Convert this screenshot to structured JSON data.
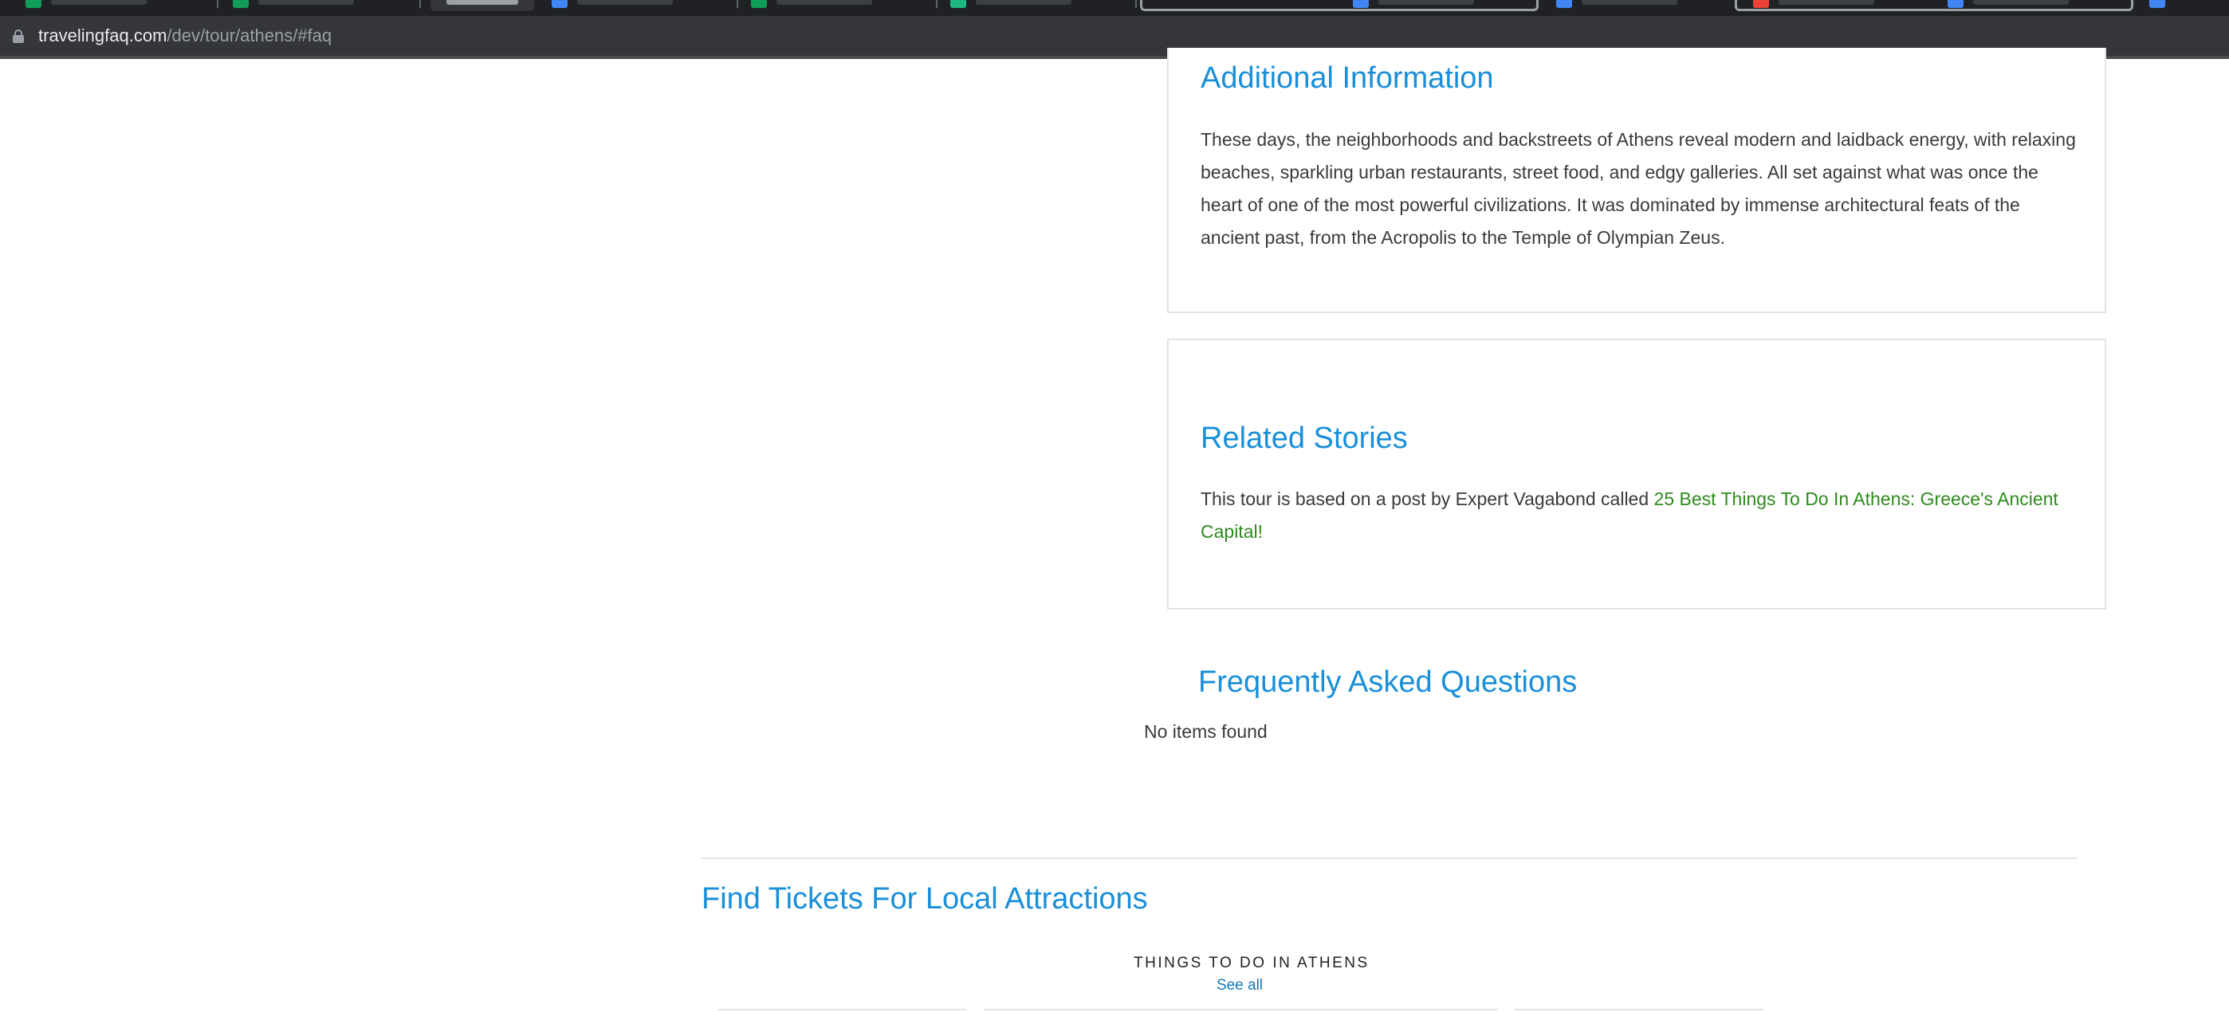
{
  "browser": {
    "url_host": "travelingfaq.com",
    "url_path": "/dev/tour/athens/#faq"
  },
  "additional_info": {
    "title": "Additional Information",
    "body": "These days, the neighborhoods and backstreets of Athens reveal modern and laidback energy, with relaxing beaches, sparkling urban restaurants, street food, and edgy galleries. All set against what was once the heart of one of the most powerful civilizations. It was dominated by immense architectural feats of the ancient past, from the Acropolis to the Temple of Olympian Zeus."
  },
  "related_stories": {
    "title": "Related Stories",
    "intro": "This tour is based on a post by Expert Vagabond called ",
    "link_text": "25 Best Things To Do In Athens: Greece's Ancient Capital!"
  },
  "faq": {
    "title": "Frequently Asked Questions",
    "empty_text": "No items found"
  },
  "tickets": {
    "title": "Find Tickets For Local Attractions",
    "caption": "THINGS TO DO IN ATHENS",
    "see_all": "See all"
  },
  "colors": {
    "heading": "#1a8fd8",
    "link": "#2f8a1e",
    "chrome_dark": "#202124"
  }
}
